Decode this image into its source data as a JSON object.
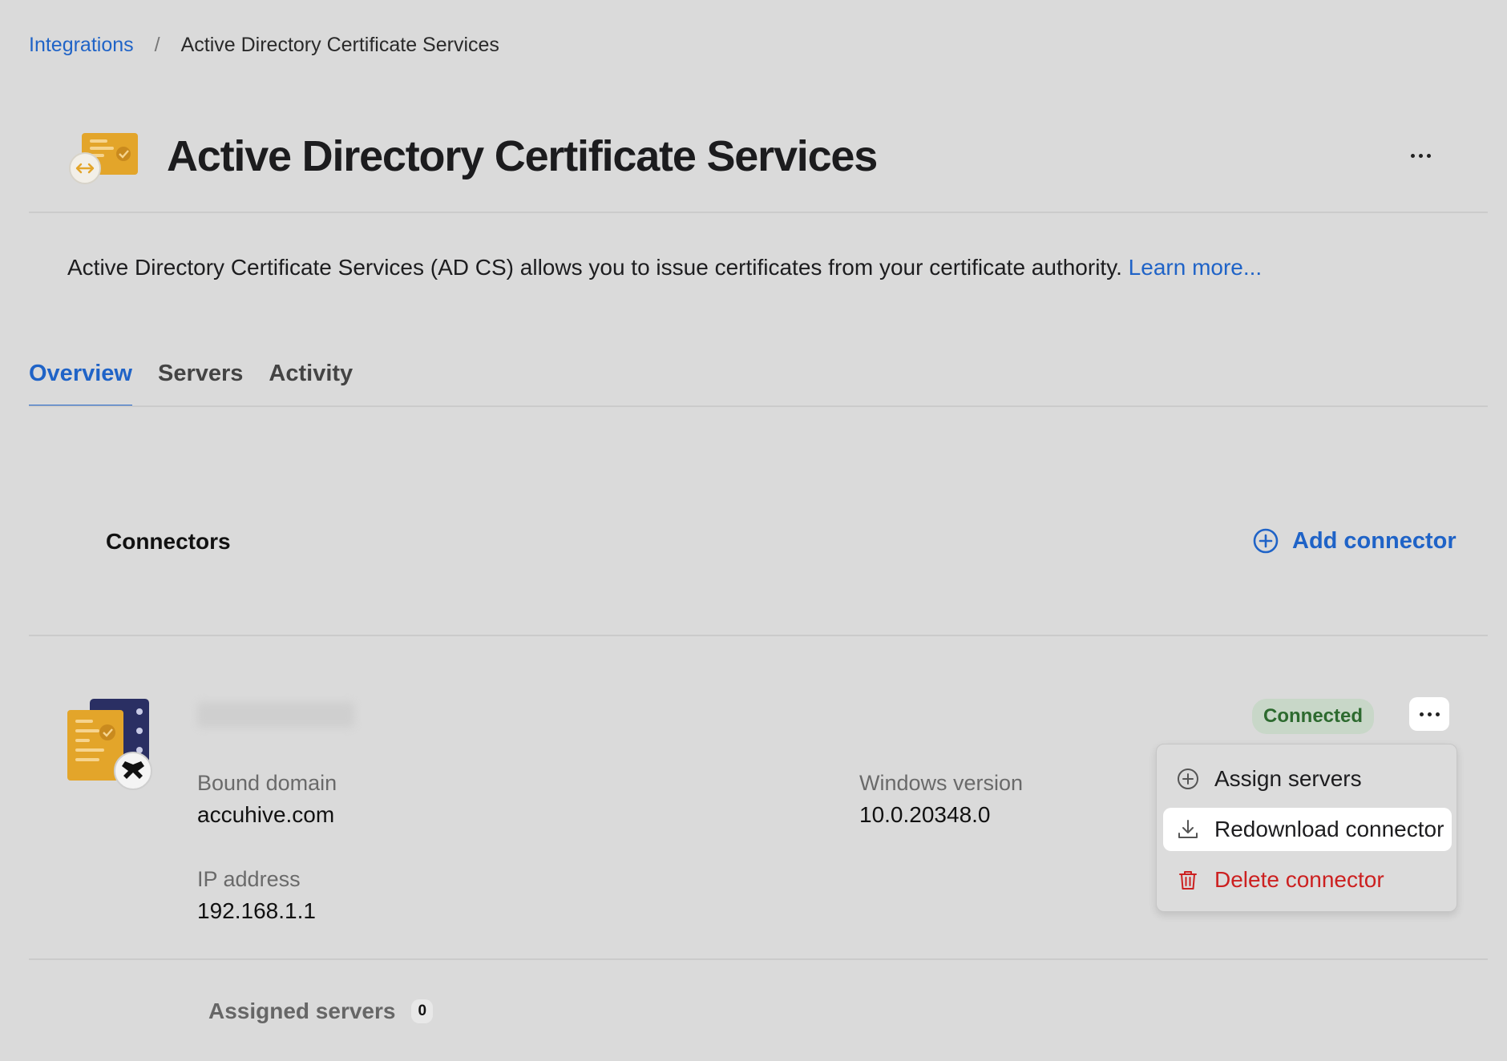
{
  "breadcrumb": {
    "parent": "Integrations",
    "separator": "/",
    "current": "Active Directory Certificate Services"
  },
  "header": {
    "title": "Active Directory Certificate Services",
    "logo_icon": "certificate-sync-icon",
    "more_icon": "ellipsis-icon"
  },
  "description": {
    "text": "Active Directory Certificate Services (AD CS) allows you to issue certificates from your certificate authority.",
    "link": "Learn more..."
  },
  "tabs": [
    {
      "label": "Overview",
      "active": true
    },
    {
      "label": "Servers",
      "active": false
    },
    {
      "label": "Activity",
      "active": false
    }
  ],
  "connectors": {
    "title": "Connectors",
    "add_label": "Add connector",
    "add_icon": "plus-circle-icon"
  },
  "connector": {
    "name": "",
    "status": "Connected",
    "bound_domain_label": "Bound domain",
    "bound_domain": "accuhive.com",
    "windows_version_label": "Windows version",
    "windows_version": "10.0.20348.0",
    "ip_label": "IP address",
    "ip": "192.168.1.1"
  },
  "menu": {
    "items": [
      {
        "label": "Assign servers",
        "icon": "plus-circle-icon"
      },
      {
        "label": "Redownload connector",
        "icon": "download-icon"
      },
      {
        "label": "Delete connector",
        "icon": "trash-icon"
      }
    ]
  },
  "assigned_servers": {
    "label": "Assigned servers",
    "count": "0"
  },
  "colors": {
    "accent": "#1f63c7",
    "danger": "#cc2020",
    "success": "#2d6a2f",
    "background": "#dadada"
  }
}
